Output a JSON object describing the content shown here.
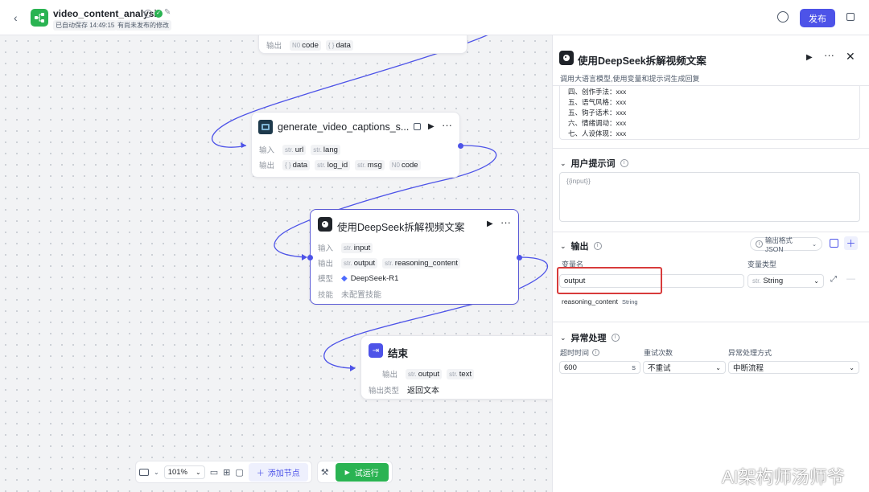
{
  "header": {
    "title": "video_content_analysis",
    "autosave": "已自动保存 14:49:15",
    "unpublished": "有尚未发布的修改",
    "publish_label": "发布"
  },
  "nodes": {
    "top": {
      "output_label": "输出",
      "outputs": [
        {
          "type": "N0",
          "name": "code"
        },
        {
          "type": "{ }",
          "name": "data"
        }
      ]
    },
    "captions": {
      "title": "generate_video_captions_s...",
      "input_label": "输入",
      "inputs": [
        {
          "type": "str.",
          "name": "url"
        },
        {
          "type": "str.",
          "name": "lang"
        }
      ],
      "output_label": "输出",
      "outputs": [
        {
          "type": "{ }",
          "name": "data"
        },
        {
          "type": "str.",
          "name": "log_id"
        },
        {
          "type": "str.",
          "name": "msg"
        },
        {
          "type": "N0",
          "name": "code"
        }
      ]
    },
    "deepseek": {
      "title": "使用DeepSeek拆解视频文案",
      "input_label": "输入",
      "inputs": [
        {
          "type": "str.",
          "name": "input"
        }
      ],
      "output_label": "输出",
      "outputs": [
        {
          "type": "str.",
          "name": "output"
        },
        {
          "type": "str.",
          "name": "reasoning_content"
        }
      ],
      "model_label": "模型",
      "model": "DeepSeek-R1",
      "skill_label": "技能",
      "skill": "未配置技能"
    },
    "end": {
      "title": "结束",
      "output_label": "输出",
      "outputs": [
        {
          "type": "str.",
          "name": "output"
        },
        {
          "type": "str.",
          "name": "text"
        }
      ],
      "type_label": "输出类型",
      "type_value": "返回文本"
    }
  },
  "toolbar": {
    "zoom": "101%",
    "add_node": "添加节点",
    "test_run": "试运行"
  },
  "panel": {
    "title": "使用DeepSeek拆解视频文案",
    "description": "调用大语言模型,使用变量和提示词生成回复",
    "system_prompt_lines": [
      "四、创作手法：xxx",
      "五、语气风格：xxx",
      "五、钩子话术：xxx",
      "六、情绪调动：xxx",
      "七、人设体现：xxx"
    ],
    "user_prompt": {
      "title": "用户提示词",
      "value": "{{input}}"
    },
    "output": {
      "title": "输出",
      "format_label": "输出格式JSON",
      "var_name_label": "变量名",
      "var_type_label": "变量类型",
      "var_name": "output",
      "var_type": "String",
      "var_type_prefix": "str.",
      "extra_name": "reasoning_content",
      "extra_type": "String"
    },
    "exception": {
      "title": "异常处理",
      "timeout_label": "超时时间",
      "timeout_value": "600",
      "timeout_unit": "s",
      "retry_label": "重试次数",
      "retry_value": "不重试",
      "method_label": "异常处理方式",
      "method_value": "中断流程"
    }
  },
  "watermark": "AI架构师汤师爷",
  "colors": {
    "accent": "#4d53e8",
    "highlight": "#d83b3b",
    "success": "#2ab352"
  }
}
